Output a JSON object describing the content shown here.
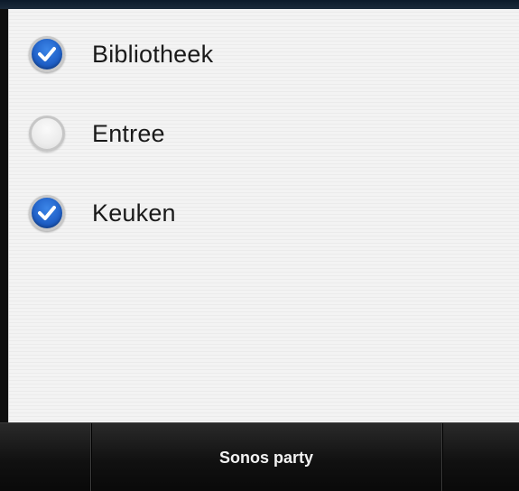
{
  "rooms": [
    {
      "label": "Bibliotheek",
      "checked": true
    },
    {
      "label": "Entree",
      "checked": false
    },
    {
      "label": "Keuken",
      "checked": true
    }
  ],
  "bottom_bar": {
    "party_label": "Sonos party"
  },
  "colors": {
    "check_blue": "#1f5fc6",
    "panel_bg": "#f3f3f3",
    "bar_bg": "#111111"
  },
  "icons": {
    "checked": "checkmark-icon",
    "unchecked": "empty-circle-icon"
  }
}
